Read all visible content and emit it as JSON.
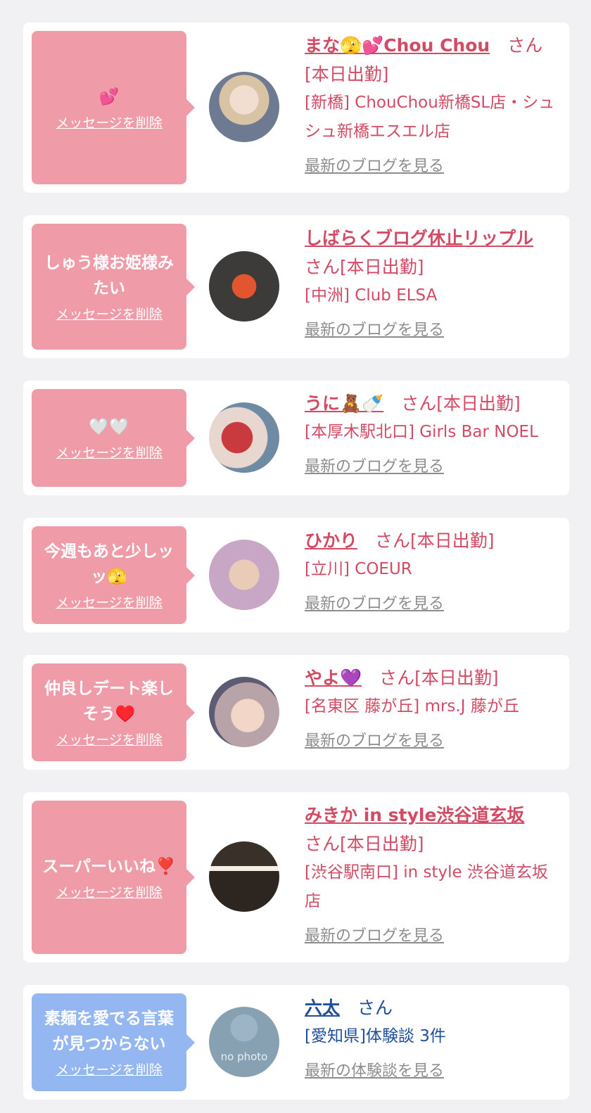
{
  "delete_label": "メッセージを削除",
  "colors": {
    "pink_bubble": "#ef9ca8",
    "blue_bubble": "#94b7f1",
    "name_pink": "#d24a63",
    "name_blue": "#1f4e9a",
    "blog_gray": "#8d8d8d"
  },
  "entries": [
    {
      "message": "💕",
      "name": "まな🫣💕Chou Chou",
      "suffix": "さん[本日出勤]",
      "shop": "[新橋] ChouChou新橋SL店・シュシュ新橋エスエル店",
      "blog_link": "最新のブログを見る"
    },
    {
      "message": "しゅう様お姫様みたい",
      "name": "しばらくブログ休止リップル",
      "suffix": "さん[本日出勤]",
      "shop": "[中洲] Club ELSA",
      "blog_link": "最新のブログを見る"
    },
    {
      "message": "🤍🤍",
      "name": "うに🧸🍼",
      "suffix": "さん[本日出勤]",
      "shop": "[本厚木駅北口] Girls Bar NOEL",
      "blog_link": "最新のブログを見る"
    },
    {
      "message": "今週もあと少しッッ🫣",
      "name": "ひかり",
      "suffix": "さん[本日出勤]",
      "shop": "[立川] COEUR",
      "blog_link": "最新のブログを見る"
    },
    {
      "message": "仲良しデート楽しそう♥️",
      "name": "やよ💜",
      "suffix": "さん[本日出勤]",
      "shop": "[名東区 藤が丘] mrs.J 藤が丘",
      "blog_link": "最新のブログを見る"
    },
    {
      "message": "スーパーいいね❣️",
      "name": "みきか in style渋谷道玄坂",
      "suffix": "さん[本日出勤]",
      "shop": "[渋谷駅南口] in style 渋谷道玄坂店",
      "blog_link": "最新のブログを見る"
    },
    {
      "message": "素麺を愛でる言葉が見つからない",
      "name": "六太",
      "suffix": "さん",
      "shop": "[愛知県]体験談 3件",
      "blog_link": "最新の体験談を見る",
      "avatar_text": "no photo"
    }
  ]
}
